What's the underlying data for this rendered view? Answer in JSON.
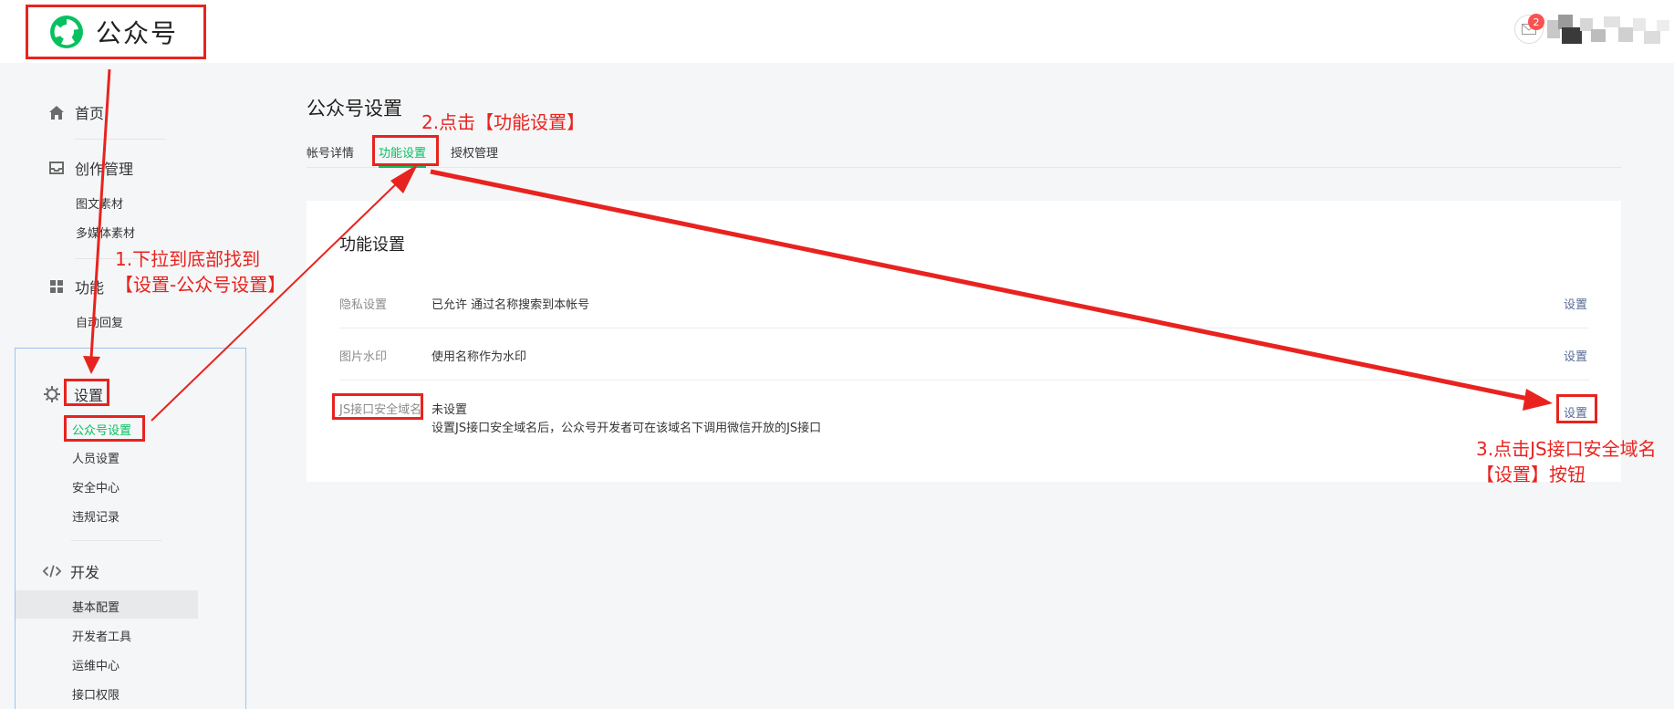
{
  "header": {
    "brand": "公众号",
    "notification_count": "2"
  },
  "sidebar": {
    "home": "首页",
    "create": {
      "title": "创作管理",
      "items": [
        "图文素材",
        "多媒体素材"
      ]
    },
    "features": {
      "title": "功能",
      "items": [
        "自动回复"
      ]
    },
    "settings": {
      "title": "设置",
      "items": [
        "公众号设置",
        "人员设置",
        "安全中心",
        "违规记录"
      ]
    },
    "develop": {
      "title": "开发",
      "items": [
        "基本配置",
        "开发者工具",
        "运维中心",
        "接口权限"
      ]
    }
  },
  "main": {
    "title": "公众号设置",
    "tabs": [
      "帐号详情",
      "功能设置",
      "授权管理"
    ],
    "active_tab": "功能设置",
    "card": {
      "title": "功能设置",
      "rows": [
        {
          "label": "隐私设置",
          "value": "已允许 通过名称搜索到本帐号",
          "action": "设置"
        },
        {
          "label": "图片水印",
          "value": "使用名称作为水印",
          "action": "设置"
        },
        {
          "label": "JS接口安全域名",
          "value": "未设置",
          "desc": "设置JS接口安全域名后，公众号开发者可在该域名下调用微信开放的JS接口",
          "action": "设置"
        }
      ]
    }
  },
  "annotations": {
    "step1_line1": "1.下拉到底部找到",
    "step1_line2": "【设置-公众号设置】",
    "step2": "2.点击【功能设置】",
    "step3_line1": "3.点击JS接口安全域名",
    "step3_line2": "【设置】按钮"
  },
  "colors": {
    "brand_green": "#07c160",
    "annotation_red": "#e8231f",
    "link_blue": "#576b95"
  }
}
